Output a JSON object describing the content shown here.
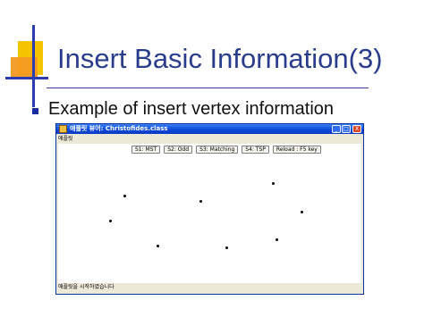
{
  "slide": {
    "title": "Insert Basic Information(3)",
    "bullet": "Example of insert vertex information"
  },
  "window": {
    "title": "애플릿 뷰어: Christofides.class",
    "menu_label": "애플릿",
    "buttons": {
      "minimize": "_",
      "maximize": "□",
      "close": "X"
    },
    "toolbar": [
      "S1: MST",
      "S2: Odd",
      "S3: Matching",
      "S4: TSP",
      "Reload : F5 key"
    ],
    "status": "애플릿을 시작하였습니다"
  },
  "colors": {
    "title_text": "#2a3c8c",
    "bullet": "#1a2aa0",
    "titlebar": "#0a46d8",
    "close_button": "#d8472a",
    "vertex": "#000000"
  }
}
